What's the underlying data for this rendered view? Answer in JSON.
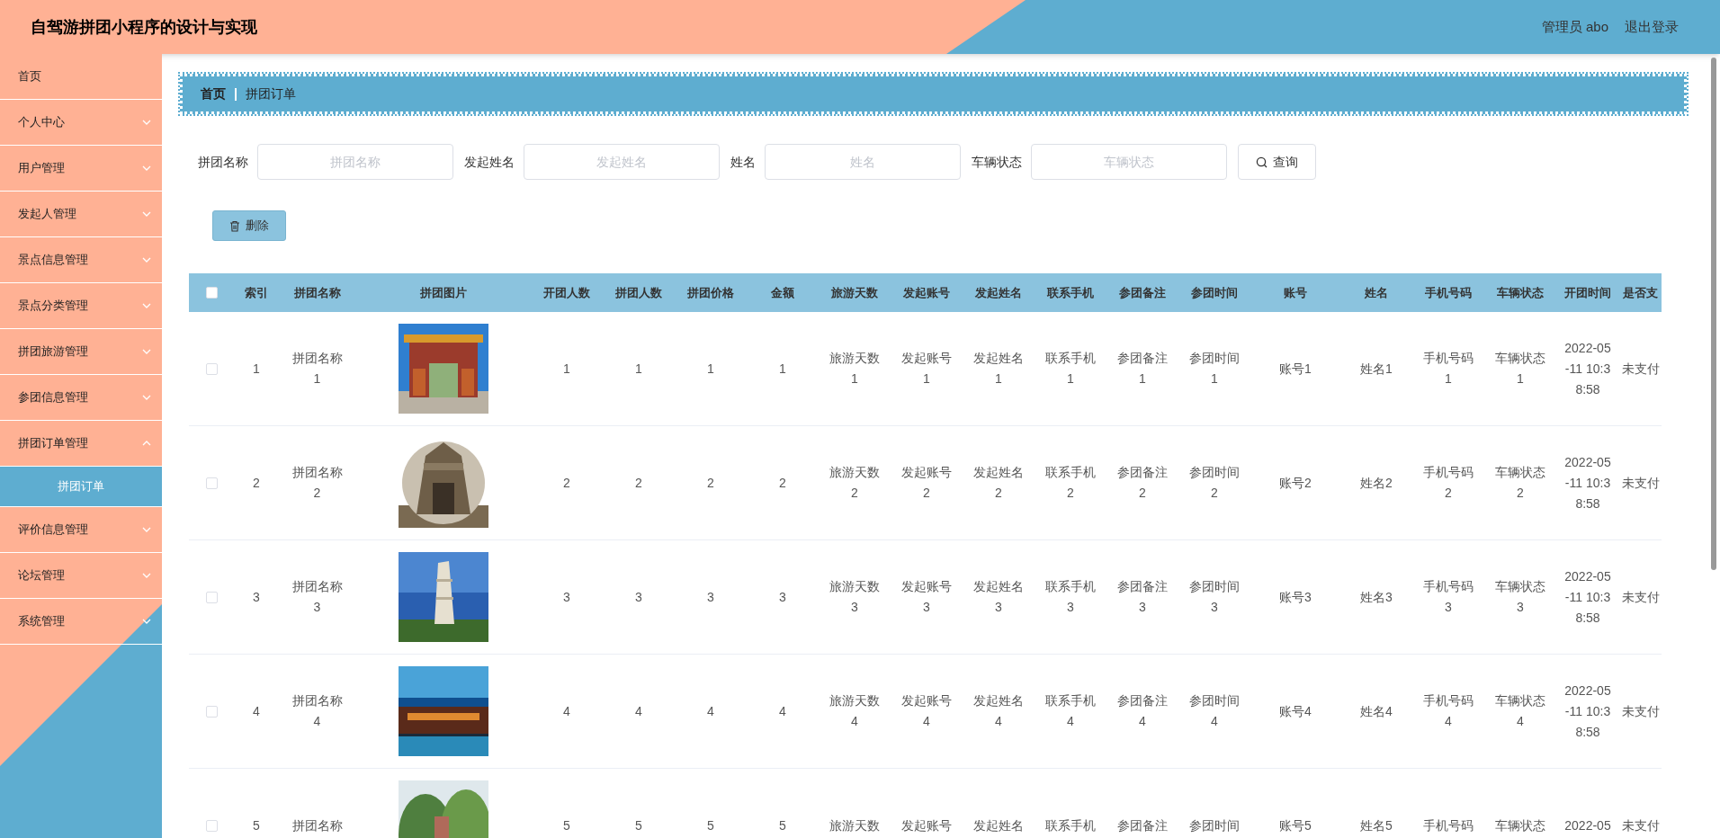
{
  "header": {
    "title": "自驾游拼团小程序的设计与实现",
    "user": "管理员 abo",
    "logout": "退出登录"
  },
  "sidebar": {
    "items": [
      {
        "label": "首页",
        "expandable": false
      },
      {
        "label": "个人中心",
        "expandable": true,
        "expanded": false
      },
      {
        "label": "用户管理",
        "expandable": true,
        "expanded": false
      },
      {
        "label": "发起人管理",
        "expandable": true,
        "expanded": false
      },
      {
        "label": "景点信息管理",
        "expandable": true,
        "expanded": false
      },
      {
        "label": "景点分类管理",
        "expandable": true,
        "expanded": false
      },
      {
        "label": "拼团旅游管理",
        "expandable": true,
        "expanded": false
      },
      {
        "label": "参团信息管理",
        "expandable": true,
        "expanded": false
      },
      {
        "label": "拼团订单管理",
        "expandable": true,
        "expanded": true,
        "children": [
          {
            "label": "拼团订单",
            "selected": true
          }
        ]
      },
      {
        "label": "评价信息管理",
        "expandable": true,
        "expanded": false
      },
      {
        "label": "论坛管理",
        "expandable": true,
        "expanded": false
      },
      {
        "label": "系统管理",
        "expandable": true,
        "expanded": false
      }
    ]
  },
  "breadcrumb": [
    "首页",
    "拼团订单"
  ],
  "search": {
    "fields": [
      {
        "label": "拼团名称",
        "placeholder": "拼团名称"
      },
      {
        "label": "发起姓名",
        "placeholder": "发起姓名"
      },
      {
        "label": "姓名",
        "placeholder": "姓名"
      },
      {
        "label": "车辆状态",
        "placeholder": "车辆状态"
      }
    ],
    "button": "查询"
  },
  "delete_button": "删除",
  "table": {
    "select_all_checked": false,
    "columns": [
      "索引",
      "拼团名称",
      "拼团图片",
      "开团人数",
      "拼团人数",
      "拼团价格",
      "金额",
      "旅游天数",
      "发起账号",
      "发起姓名",
      "联系手机",
      "参团备注",
      "参团时间",
      "账号",
      "姓名",
      "手机号码",
      "车辆状态",
      "开团时间",
      "是否支"
    ],
    "rows": [
      {
        "checked": false,
        "cells": [
          "1",
          "拼团名称1",
          null,
          "1",
          "1",
          "1",
          "1",
          "旅游天数1",
          "发起账号1",
          "发起姓名1",
          "联系手机1",
          "参团备注1",
          "参团时间1",
          "账号1",
          "姓名1",
          "手机号码1",
          "车辆状态1",
          "2022-05-11 10:38:58",
          "未支付"
        ]
      },
      {
        "checked": false,
        "cells": [
          "2",
          "拼团名称2",
          null,
          "2",
          "2",
          "2",
          "2",
          "旅游天数2",
          "发起账号2",
          "发起姓名2",
          "联系手机2",
          "参团备注2",
          "参团时间2",
          "账号2",
          "姓名2",
          "手机号码2",
          "车辆状态2",
          "2022-05-11 10:38:58",
          "未支付"
        ]
      },
      {
        "checked": false,
        "cells": [
          "3",
          "拼团名称3",
          null,
          "3",
          "3",
          "3",
          "3",
          "旅游天数3",
          "发起账号3",
          "发起姓名3",
          "联系手机3",
          "参团备注3",
          "参团时间3",
          "账号3",
          "姓名3",
          "手机号码3",
          "车辆状态3",
          "2022-05-11 10:38:58",
          "未支付"
        ]
      },
      {
        "checked": false,
        "cells": [
          "4",
          "拼团名称4",
          null,
          "4",
          "4",
          "4",
          "4",
          "旅游天数4",
          "发起账号4",
          "发起姓名4",
          "联系手机4",
          "参团备注4",
          "参团时间4",
          "账号4",
          "姓名4",
          "手机号码4",
          "车辆状态4",
          "2022-05-11 10:38:58",
          "未支付"
        ]
      },
      {
        "checked": false,
        "cells": [
          "5",
          "拼团名称",
          null,
          "5",
          "5",
          "5",
          "5",
          "旅游天数",
          "发起账号",
          "发起姓名",
          "联系手机",
          "参团备注",
          "参团时间",
          "账号5",
          "姓名5",
          "手机号码",
          "车辆状态",
          "2022-05",
          "未支付"
        ]
      }
    ]
  }
}
